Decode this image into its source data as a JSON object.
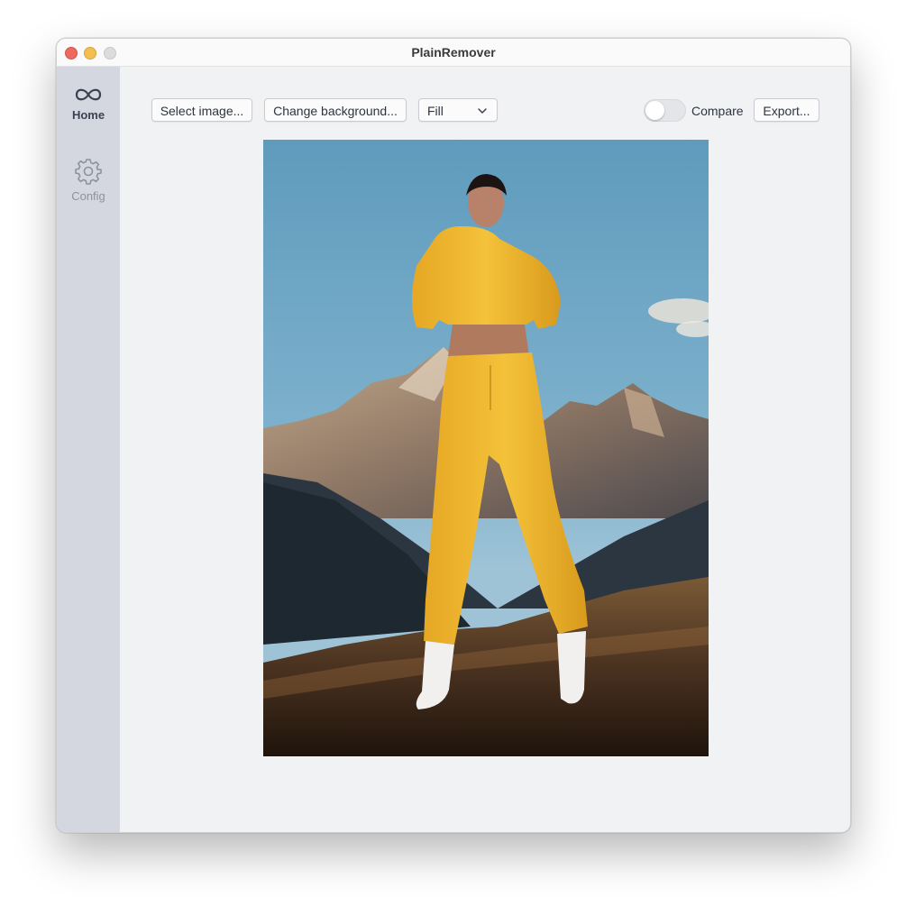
{
  "window": {
    "title": "PlainRemover"
  },
  "sidebar": {
    "items": [
      {
        "label": "Home",
        "icon": "infinity-icon",
        "active": true
      },
      {
        "label": "Config",
        "icon": "gear-icon",
        "active": false
      }
    ]
  },
  "toolbar": {
    "select_image_label": "Select image...",
    "change_background_label": "Change background...",
    "fit_mode": {
      "selected": "Fill"
    },
    "compare": {
      "label": "Compare",
      "enabled": false
    },
    "export_label": "Export..."
  },
  "preview": {
    "description_icon": "photo-preview",
    "colors": {
      "sky": "#6ea5c2",
      "outfit": "#f2b82e",
      "mountain": "#9b8470",
      "ground": "#4a3220"
    }
  }
}
